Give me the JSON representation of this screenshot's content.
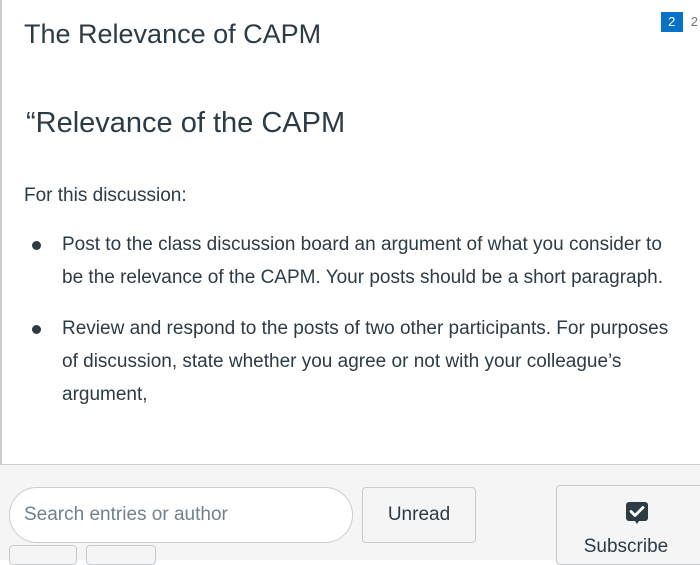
{
  "header": {
    "title": "The Relevance of CAPM",
    "unread_count": "2",
    "total_count": "2",
    "unread_badge_color": "#0770c9"
  },
  "content": {
    "heading": "“Relevance of the CAPM",
    "intro": "For this discussion:",
    "bullets": [
      "Post to the class discussion board an argument of what you consider to be the relevance of the CAPM. Your posts should be a short paragraph.",
      "Review and respond to the posts of two other participants. For purposes of discussion, state whether you agree or not with your colleague’s argument,"
    ]
  },
  "toolbar": {
    "search_placeholder": "Search entries or author",
    "search_value": "",
    "unread_label": "Unread",
    "subscribe_label": "Subscribe",
    "subscribe_icon": "checkmark-box-icon"
  }
}
